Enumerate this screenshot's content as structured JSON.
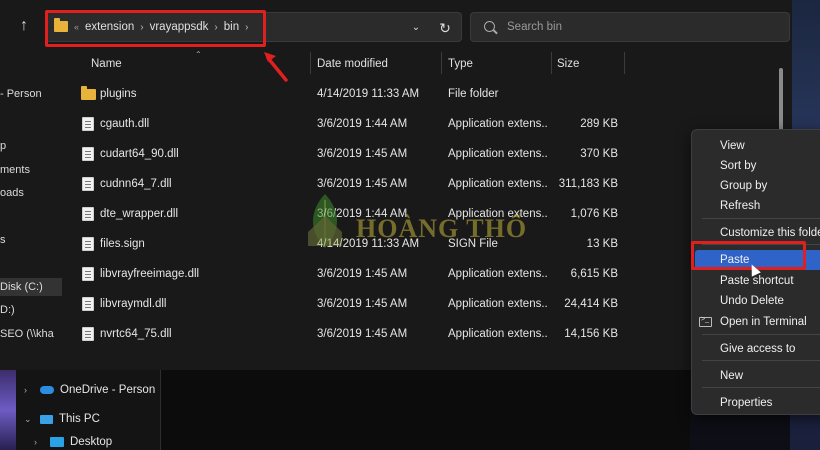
{
  "address_bar": {
    "crumbs": [
      "extension",
      "vrayappsdk",
      "bin"
    ],
    "overflow_glyph": "«",
    "separator": "›"
  },
  "search": {
    "placeholder": "Search bin"
  },
  "nav_pane": {
    "items": [
      "- Person",
      "p",
      "ments",
      "oads",
      "s",
      "Disk (C:)",
      "D:)",
      "SEO (\\\\kha"
    ]
  },
  "columns": {
    "name": "Name",
    "date": "Date modified",
    "type": "Type",
    "size": "Size"
  },
  "files": [
    {
      "name": "plugins",
      "date": "4/14/2019 11:33 AM",
      "type": "File folder",
      "size": "",
      "kind": "folder"
    },
    {
      "name": "cgauth.dll",
      "date": "3/6/2019 1:44 AM",
      "type": "Application extens...",
      "size": "289 KB",
      "kind": "file"
    },
    {
      "name": "cudart64_90.dll",
      "date": "3/6/2019 1:45 AM",
      "type": "Application extens...",
      "size": "370 KB",
      "kind": "file"
    },
    {
      "name": "cudnn64_7.dll",
      "date": "3/6/2019 1:45 AM",
      "type": "Application extens...",
      "size": "311,183 KB",
      "kind": "file"
    },
    {
      "name": "dte_wrapper.dll",
      "date": "3/6/2019 1:44 AM",
      "type": "Application extens...",
      "size": "1,076 KB",
      "kind": "file"
    },
    {
      "name": "files.sign",
      "date": "4/14/2019 11:33 AM",
      "type": "SIGN File",
      "size": "13 KB",
      "kind": "file"
    },
    {
      "name": "libvrayfreeimage.dll",
      "date": "3/6/2019 1:45 AM",
      "type": "Application extens...",
      "size": "6,615 KB",
      "kind": "file"
    },
    {
      "name": "libvraymdl.dll",
      "date": "3/6/2019 1:45 AM",
      "type": "Application extens...",
      "size": "24,414 KB",
      "kind": "file"
    },
    {
      "name": "nvrtc64_75.dll",
      "date": "3/6/2019 1:45 AM",
      "type": "Application extens...",
      "size": "14,156 KB",
      "kind": "file"
    }
  ],
  "tree": {
    "onedrive": "OneDrive - Person",
    "this_pc": "This PC",
    "desktop": "Desktop"
  },
  "watermark": {
    "text": "HOÀNG THỔ"
  },
  "context_menu": {
    "view": "View",
    "sort_by": "Sort by",
    "group_by": "Group by",
    "refresh": "Refresh",
    "customize": "Customize this folder",
    "paste": "Paste",
    "paste_shortcut": "Paste shortcut",
    "undo_delete": "Undo Delete",
    "open_terminal": "Open in Terminal",
    "give_access": "Give access to",
    "new": "New",
    "properties": "Properties"
  },
  "colors": {
    "highlight": "#e0201e",
    "menu_active": "#2f63c8",
    "folder": "#e8b33a"
  }
}
